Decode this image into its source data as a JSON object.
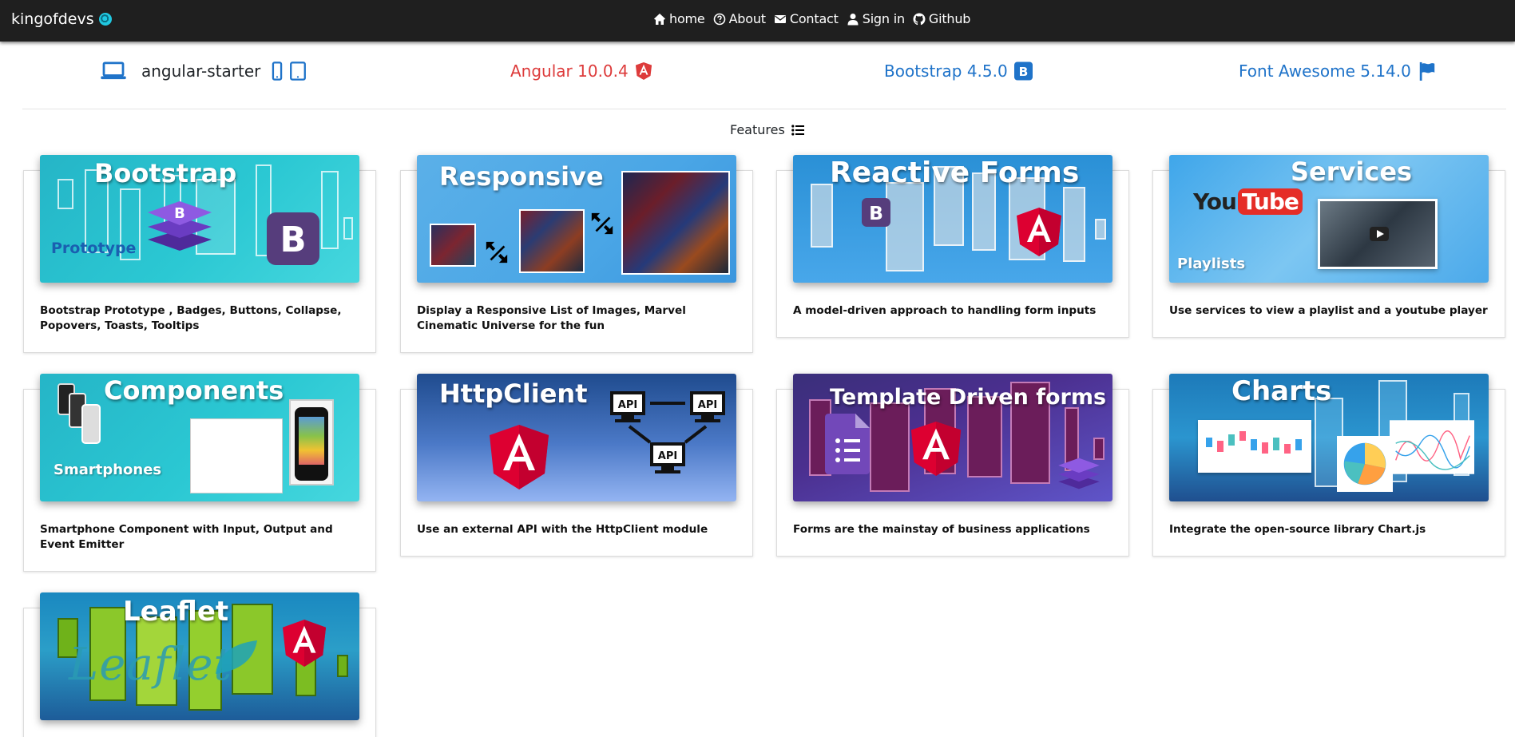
{
  "navbar": {
    "brand": "kingofdevs",
    "links": [
      {
        "label": "home",
        "icon": "home-icon"
      },
      {
        "label": "About",
        "icon": "question-circle-icon"
      },
      {
        "label": "Contact",
        "icon": "envelope-icon"
      },
      {
        "label": "Sign in",
        "icon": "user-icon"
      },
      {
        "label": "Github",
        "icon": "github-icon"
      }
    ]
  },
  "info": {
    "starter": "angular-starter",
    "angular": "Angular 10.0.4",
    "bootstrap": "Bootstrap 4.5.0",
    "fontawesome": "Font Awesome 5.14.0"
  },
  "features_label": "Features",
  "colors": {
    "navbar_bg": "#1f1f1f",
    "angular_red": "#dd3b3b",
    "bootstrap_blue": "#1f73c9",
    "bootstrap_purple": "#563d7c",
    "icon_blue": "#1f73c9"
  },
  "cards": [
    {
      "title": "Bootstrap",
      "subtitle": "Prototype",
      "text": "Bootstrap Prototype , Badges, Buttons, Collapse, Popovers, Toasts, Tooltips"
    },
    {
      "title": "Responsive",
      "text": "Display a Responsive List of Images, Marvel Cinematic Universe for the fun"
    },
    {
      "title": "Reactive Forms",
      "text": "A model-driven approach to handling form inputs"
    },
    {
      "title": "Services",
      "subtitle": "Playlists",
      "logo": "YouTube",
      "text": "Use services to view a playlist and a youtube player"
    },
    {
      "title": "Components",
      "subtitle": "Smartphones",
      "text": "Smartphone Component with Input, Output and Event Emitter"
    },
    {
      "title": "HttpClient",
      "api": "API",
      "text": "Use an external API with the HttpClient module"
    },
    {
      "title": "Template Driven forms",
      "text": "Forms are the mainstay of business applications"
    },
    {
      "title": "Charts",
      "text": "Integrate the open-source library Chart.js"
    },
    {
      "title": "Leaflet",
      "logo": "Leaflet",
      "text": ""
    }
  ]
}
